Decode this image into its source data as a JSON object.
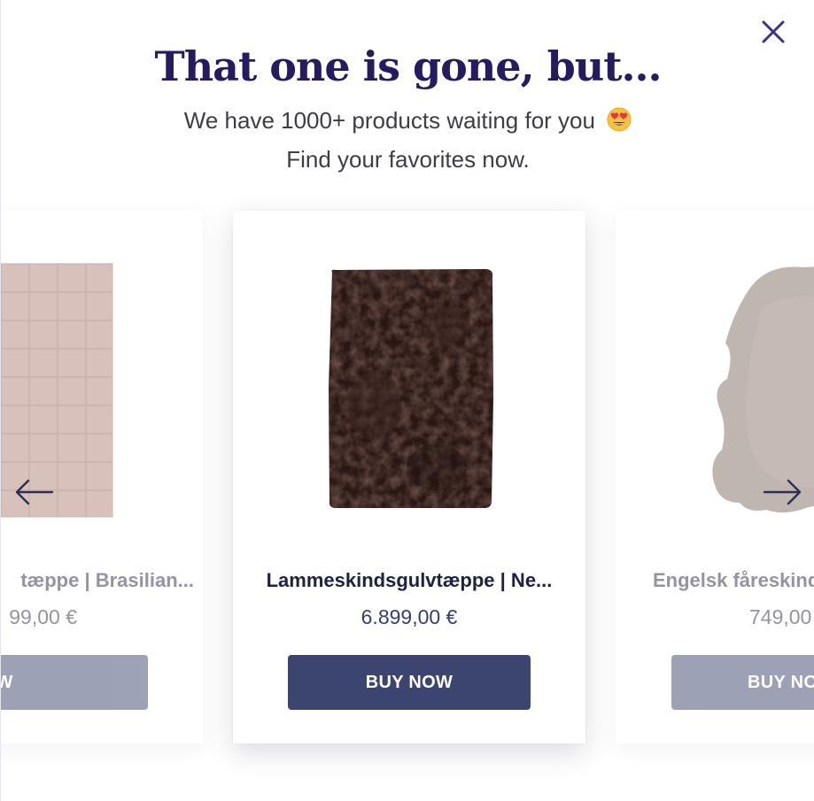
{
  "modal": {
    "headline": "That one is gone, but...",
    "subline_1": "We have 1000+ products waiting for you",
    "subline_emoji": "heart-eyes-emoji",
    "subline_2": "Find your favorites now."
  },
  "icons": {
    "close": "close-icon",
    "prev": "arrow-left-icon",
    "next": "arrow-right-icon"
  },
  "colors": {
    "headline": "#241c5e",
    "button": "#3b4570",
    "close_icon": "#3a3388"
  },
  "carousel": {
    "products": [
      {
        "name": "tæppe | Brasilian...",
        "price": "99,00 €",
        "button": "UY NOW"
      },
      {
        "name": "Lammeskindsgulvtæppe | Ne...",
        "price": "6.899,00 €",
        "button": "BUY NOW"
      },
      {
        "name": "Engelsk fåreskind",
        "price": "749,00",
        "button": "BUY NO"
      }
    ]
  }
}
